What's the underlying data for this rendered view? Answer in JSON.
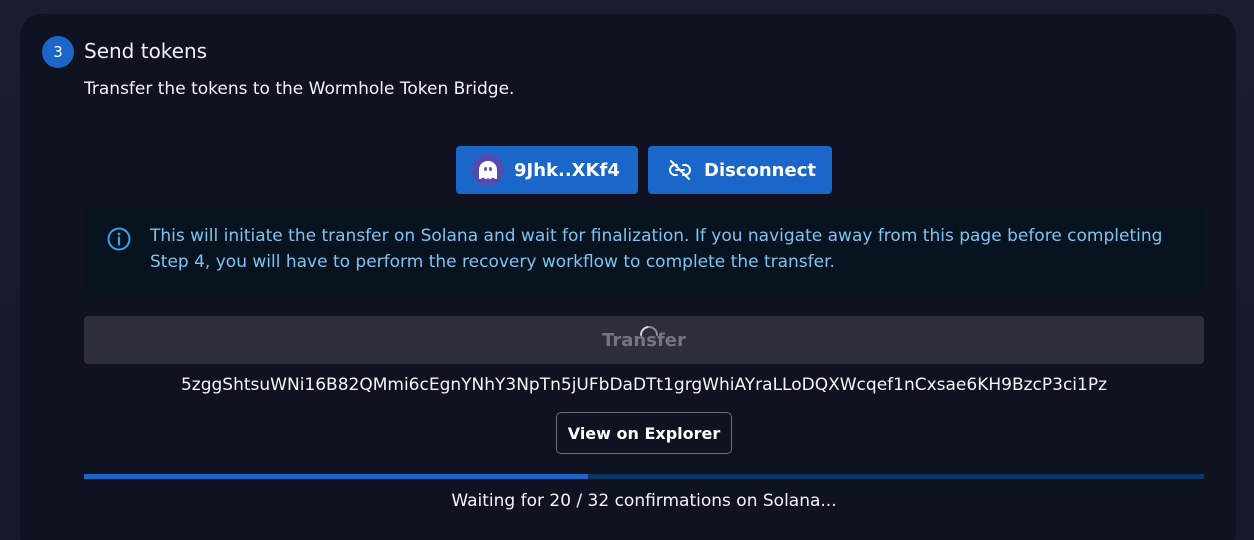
{
  "step": {
    "number": "3",
    "title": "Send tokens",
    "description": "Transfer the tokens to the Wormhole Token Bridge."
  },
  "wallet": {
    "address_label": "9Jhk..XKf4",
    "wallet_icon": "phantom-ghost-icon",
    "disconnect_label": "Disconnect",
    "disconnect_icon": "unlink-icon"
  },
  "alert": {
    "icon": "info-icon",
    "text": "This will initiate the transfer on Solana and wait for finalization. If you navigate away from this page before completing Step 4, you will have to perform the recovery workflow to complete the transfer."
  },
  "transfer": {
    "label": "Transfer",
    "state": "loading",
    "spinner_icon": "spinner-icon"
  },
  "transaction": {
    "hash": "5zggShtsuWNi16B82QMmi6cEgnYNhY3NpTn5jUFbDaDTt1grgWhiAYraLLoDQXWcqef1nCxsae6KH9BzcP3ci1Pz",
    "explorer_label": "View on Explorer"
  },
  "confirmations": {
    "current": 20,
    "required": 32,
    "progress_fraction": 0.45,
    "status_text": "Waiting for 20 / 32 confirmations on Solana..."
  },
  "colors": {
    "accent": "#1b66c9",
    "alert_text": "#7fc3f2",
    "card_background": "#0f1220",
    "page_background": "#171a2b"
  }
}
